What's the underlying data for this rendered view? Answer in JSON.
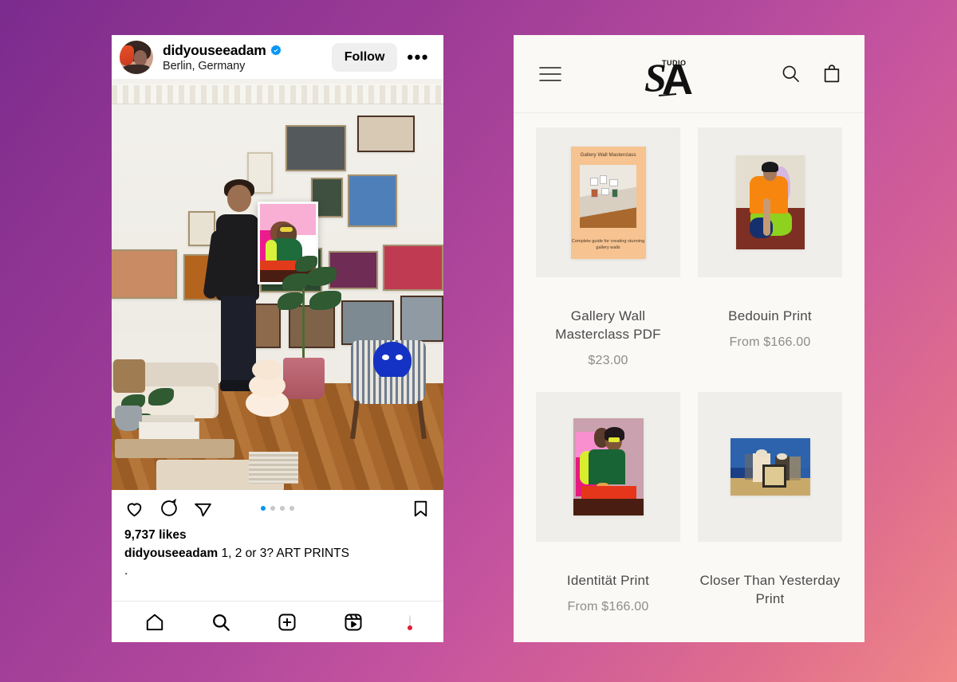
{
  "background": {
    "gradient_from": "#7b2b8e",
    "gradient_to": "#f08787"
  },
  "instagram": {
    "panel_name": "instagram-post",
    "header": {
      "username": "didyouseeadam",
      "verified_icon": "verified-badge-icon",
      "location": "Berlin, Germany",
      "follow_label": "Follow",
      "more_label": "•••",
      "avatar_icon": "profile-avatar"
    },
    "photo": {
      "alt": "Man holding an art print in a room with a gallery wall",
      "carousel": {
        "total": 4,
        "active_index": 0
      }
    },
    "actions": {
      "like_icon": "heart-icon",
      "comment_icon": "comment-icon",
      "share_icon": "share-icon",
      "save_icon": "bookmark-icon"
    },
    "likes": "9,737 likes",
    "caption_user": "didyouseeadam",
    "caption_text": "1, 2 or 3? ART PRINTS",
    "caption_second_line": ".",
    "navbar": [
      {
        "name": "home",
        "icon": "home-icon"
      },
      {
        "name": "search",
        "icon": "search-icon"
      },
      {
        "name": "create",
        "icon": "plus-square-icon"
      },
      {
        "name": "reels",
        "icon": "reels-icon"
      },
      {
        "name": "profile",
        "icon": "profile-avatar-icon",
        "badge": true
      }
    ]
  },
  "shop": {
    "panel_name": "shop-storefront",
    "header": {
      "menu_icon": "hamburger-menu-icon",
      "logo_text": "STUDIO",
      "logo_monogram": "SA",
      "search_icon": "search-icon",
      "cart_icon": "shopping-bag-icon"
    },
    "products": [
      {
        "title": "Gallery Wall Masterclass PDF",
        "price": "$23.00",
        "art": "pdf-cover",
        "cover_title": "Gallery Wall Masterclass",
        "cover_subtitle": "Complete guide for creating stunning gallery walls"
      },
      {
        "title": "Bedouin Print",
        "price": "From $166.00",
        "art": "bedouin-figure"
      },
      {
        "title": "Identität Print",
        "price": "From $166.00",
        "art": "identitat-figure"
      },
      {
        "title": "Closer Than Yesterday Print",
        "price": "",
        "art": "closer-than-yesterday-seascape"
      }
    ]
  }
}
